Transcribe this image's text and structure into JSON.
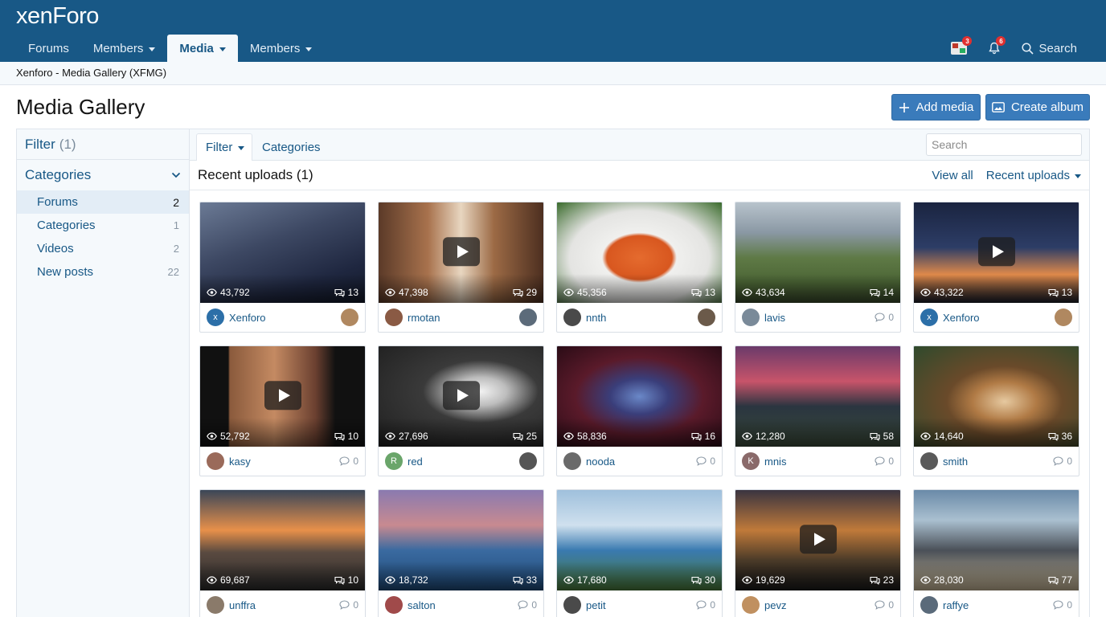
{
  "header": {
    "logo_main": "xenFor",
    "logo_end": "o",
    "nav": [
      {
        "label": "Forums",
        "caret": false,
        "active": false
      },
      {
        "label": "Members",
        "caret": true,
        "active": false
      },
      {
        "label": "Media",
        "caret": true,
        "active": true
      },
      {
        "label": "Members",
        "caret": true,
        "active": false
      }
    ],
    "flag_badge": "3",
    "alerts_badge": "6",
    "search_label": "Search"
  },
  "breadcrumb": "Xenforo - Media Gallery (XFMG)",
  "page": {
    "title": "Media Gallery",
    "add_media_label": "Add media",
    "create_album_label": "Create album"
  },
  "sidebar": {
    "filter_label": "Filter",
    "filter_count": "(1)",
    "categories_label": "Categories",
    "items": [
      {
        "label": "Forums",
        "count": "2"
      },
      {
        "label": "Categories",
        "count": "1"
      },
      {
        "label": "Videos",
        "count": "2"
      },
      {
        "label": "New posts",
        "count": "22"
      }
    ]
  },
  "main": {
    "tab_filter": "Filter",
    "tab_categories": "Categories",
    "search_placeholder": "Search",
    "section_title": "Recent uploads (1)",
    "view_all": "View all",
    "sort_label": "Recent uploads"
  },
  "media": [
    {
      "views": "43,792",
      "comments": "13",
      "user": "Xenforo",
      "video": false,
      "bg": "linear-gradient(160deg,#6b7a95 0%,#3d4863 40%,#1f2740 75%,#121828 100%)",
      "avatar_bg": "#2c6fa8",
      "avatar_text": "x",
      "tail_avatar_bg": "#b08860",
      "tail_count": ""
    },
    {
      "views": "47,398",
      "comments": "29",
      "user": "rmotan",
      "video": true,
      "bg": "linear-gradient(90deg,#5b3a28 0%,#a8724d 30%,#e8d6c0 50%,#9c6a45 70%,#4d2f20 100%)",
      "avatar_bg": "#8a5a44",
      "avatar_text": "",
      "tail_avatar_bg": "#5c6b7a",
      "tail_count": ""
    },
    {
      "views": "45,356",
      "comments": "13",
      "user": "nnth",
      "video": false,
      "bg": "radial-gradient(ellipse at 50% 55%,#e56b2e 0%,#d8571f 28%,#f0f0ee 32%,#e4e4e2 60%,#3a6b2c 100%)",
      "avatar_bg": "#4a4a4a",
      "avatar_text": "",
      "tail_avatar_bg": "#6b5a4a",
      "tail_count": ""
    },
    {
      "views": "43,634",
      "comments": "14",
      "user": "lavis",
      "video": false,
      "bg": "linear-gradient(180deg,#b8c3cc 0%,#8a98a4 30%,#5f7a46 55%,#4b6535 80%,#3a4a2c 100%)",
      "avatar_bg": "#7a8a99",
      "avatar_text": "",
      "tail_avatar_bg": "",
      "tail_count": "0"
    },
    {
      "views": "43,322",
      "comments": "13",
      "user": "Xenforo",
      "video": true,
      "bg": "linear-gradient(180deg,#1a2440 0%,#2d3d66 45%,#e08a4a 72%,#1a1e2a 100%)",
      "avatar_bg": "#2c6fa8",
      "avatar_text": "x",
      "tail_avatar_bg": "#b08860",
      "tail_count": ""
    },
    {
      "views": "52,792",
      "comments": "10",
      "user": "kasy",
      "video": true,
      "bg": "linear-gradient(90deg,#111 0%,#111 17%,#8a5a3c 18%,#c48a62 45%,#6b4030 70%,#111 82%,#111 100%)",
      "avatar_bg": "#9a6a5a",
      "avatar_text": "",
      "tail_avatar_bg": "",
      "tail_count": "0"
    },
    {
      "views": "27,696",
      "comments": "25",
      "user": "red",
      "video": true,
      "bg": "radial-gradient(ellipse at 62% 45%,#f2f2f2 0%,#bdbdbd 18%,#3a3a3a 40%,#1e1e1e 100%)",
      "avatar_bg": "#6aa56a",
      "avatar_text": "R",
      "tail_avatar_bg": "#555",
      "tail_count": ""
    },
    {
      "views": "58,836",
      "comments": "16",
      "user": "nooda",
      "video": false,
      "bg": "radial-gradient(ellipse at 50% 50%,#6a88c8 0%,#3a3e7a 25%,#5a1a2a 55%,#2a0c16 100%)",
      "avatar_bg": "#6a6a6a",
      "avatar_text": "",
      "tail_avatar_bg": "",
      "tail_count": "0"
    },
    {
      "views": "12,280",
      "comments": "58",
      "user": "mnis",
      "video": false,
      "bg": "linear-gradient(180deg,#6a3a6a 0%,#c8546a 35%,#2a3540 60%,#3a4a3a 100%)",
      "avatar_bg": "#8a6a6a",
      "avatar_text": "K",
      "tail_avatar_bg": "",
      "tail_count": "0"
    },
    {
      "views": "14,640",
      "comments": "36",
      "user": "smith",
      "video": false,
      "bg": "radial-gradient(ellipse at 55% 55%,#e6c9a0 0%,#b07a45 25%,#6a4a2a 45%,#2f4a2c 100%)",
      "avatar_bg": "#5a5a5a",
      "avatar_text": "",
      "tail_avatar_bg": "",
      "tail_count": "0"
    },
    {
      "views": "69,687",
      "comments": "10",
      "user": "unffra",
      "video": false,
      "bg": "linear-gradient(180deg,#3a4658 0%,#e8904a 40%,#5a4a40 62%,#2a2a2a 100%)",
      "avatar_bg": "#8a7a6a",
      "avatar_text": "",
      "tail_avatar_bg": "",
      "tail_count": "0"
    },
    {
      "views": "18,732",
      "comments": "33",
      "user": "salton",
      "video": false,
      "bg": "linear-gradient(180deg,#8a7ab0 0%,#c88a90 35%,#3a6aa0 60%,#1f4a78 100%)",
      "avatar_bg": "#a04a4a",
      "avatar_text": "",
      "tail_avatar_bg": "",
      "tail_count": "0"
    },
    {
      "views": "17,680",
      "comments": "30",
      "user": "petit",
      "video": false,
      "bg": "linear-gradient(180deg,#9fc0dc 0%,#cfe0ee 35%,#3a7ab0 60%,#4a7a3a 100%)",
      "avatar_bg": "#4a4a4a",
      "avatar_text": "",
      "tail_avatar_bg": "",
      "tail_count": "0"
    },
    {
      "views": "19,629",
      "comments": "23",
      "user": "pevz",
      "video": true,
      "bg": "linear-gradient(180deg,#3a3440 0%,#c07a3a 40%,#4a3a28 70%,#1a1a1a 100%)",
      "avatar_bg": "#c09060",
      "avatar_text": "",
      "tail_avatar_bg": "",
      "tail_count": "0"
    },
    {
      "views": "28,030",
      "comments": "77",
      "user": "raffye",
      "video": false,
      "bg": "linear-gradient(180deg,#6a8aa8 0%,#aac0d0 30%,#4a5058 60%,#c8b898 100%)",
      "avatar_bg": "#5a6a7a",
      "avatar_text": "",
      "tail_avatar_bg": "",
      "tail_count": "0"
    }
  ]
}
